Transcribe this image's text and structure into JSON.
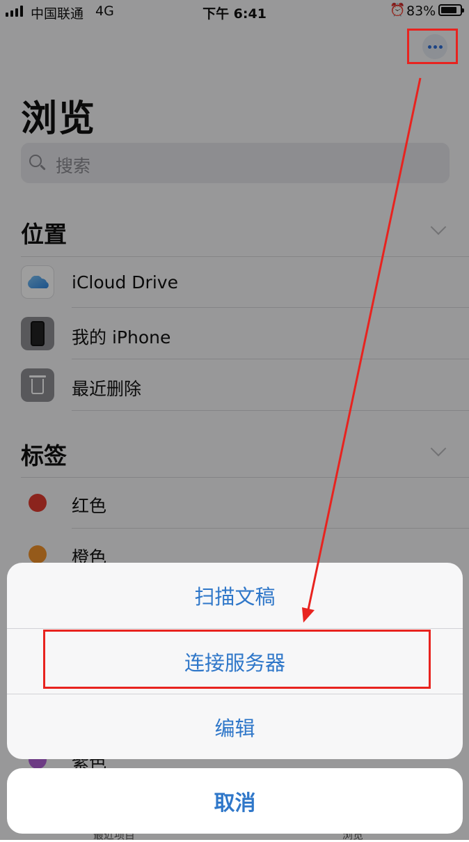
{
  "status_bar": {
    "carrier": "中国联通",
    "network": "4G",
    "time": "下午 6:41",
    "battery": "83%",
    "battery_level": 0.83
  },
  "page": {
    "title": "浏览",
    "search_placeholder": "搜索"
  },
  "locations": {
    "header": "位置",
    "items": [
      {
        "label": "iCloud Drive",
        "icon": "icloud-icon"
      },
      {
        "label": "我的 iPhone",
        "icon": "iphone-icon"
      },
      {
        "label": "最近删除",
        "icon": "trash-icon"
      }
    ]
  },
  "tags": {
    "header": "标签",
    "items": [
      {
        "label": "红色",
        "color": "#e03b30"
      },
      {
        "label": "橙色",
        "color": "#f0922b"
      },
      {
        "label": "紫色",
        "color": "#b05fd6"
      }
    ]
  },
  "tabbar": {
    "items": [
      "最近项目",
      "浏览"
    ]
  },
  "action_sheet": {
    "actions": [
      "扫描文稿",
      "连接服务器",
      "编辑"
    ],
    "cancel": "取消"
  },
  "colors": {
    "accent": "#2f77c9",
    "annotation": "#e8231f"
  }
}
